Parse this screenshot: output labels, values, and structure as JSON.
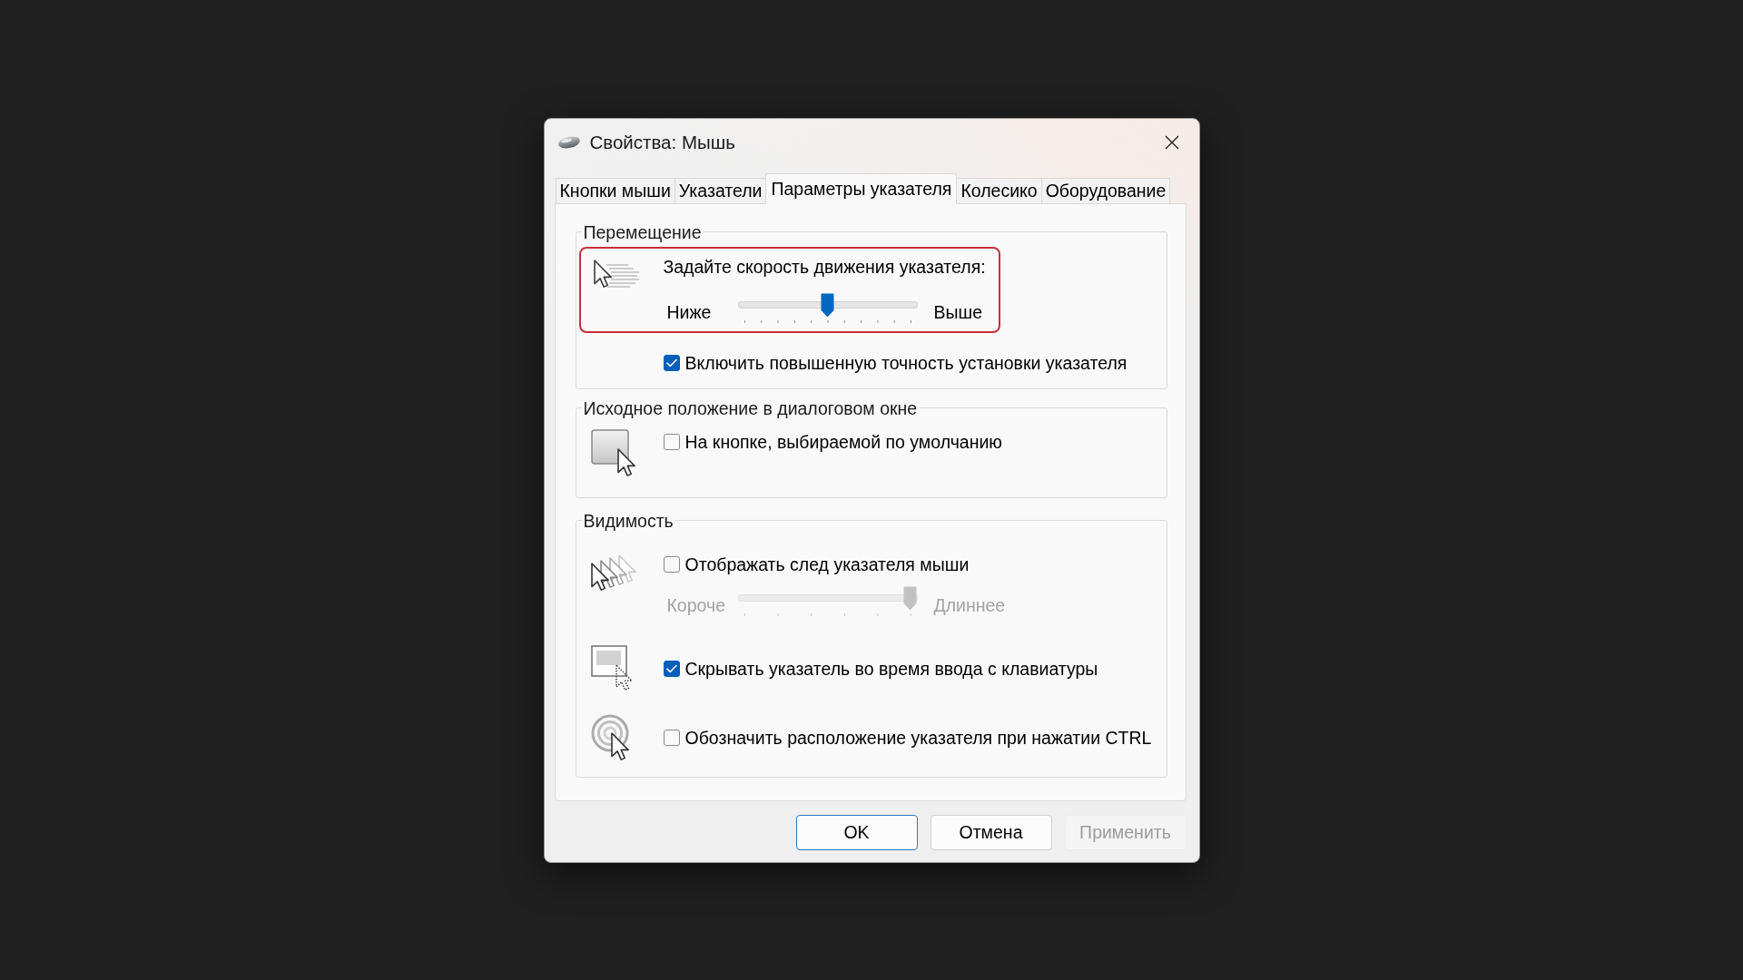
{
  "window": {
    "title": "Свойства: Мышь"
  },
  "tabs": [
    {
      "label": "Кнопки мыши",
      "selected": false
    },
    {
      "label": "Указатели",
      "selected": false
    },
    {
      "label": "Параметры указателя",
      "selected": true
    },
    {
      "label": "Колесико",
      "selected": false
    },
    {
      "label": "Оборудование",
      "selected": false
    }
  ],
  "groups": [
    {
      "title": "Перемещение",
      "sections": [
        {
          "highlighted": true,
          "controls": [
            {
              "kind": "label",
              "text": "Задайте скорость движения указателя:"
            },
            {
              "kind": "slider",
              "min_label": "Ниже",
              "max_label": "Выше",
              "level": 0.5,
              "disabled": false
            }
          ]
        },
        {
          "highlighted": false,
          "controls": [
            {
              "kind": "checkbox",
              "label": "Включить повышенную точность установки указателя",
              "checked": true
            }
          ]
        }
      ]
    },
    {
      "title": "Исходное положение в диалоговом окне",
      "sections": [
        {
          "highlighted": false,
          "controls": [
            {
              "kind": "checkbox",
              "label": "На кнопке, выбираемой по умолчанию",
              "checked": false
            }
          ]
        }
      ]
    },
    {
      "title": "Видимость",
      "sections": [
        {
          "highlighted": false,
          "controls": [
            {
              "kind": "checkbox",
              "label": "Отображать след указателя мыши",
              "checked": false
            },
            {
              "kind": "slider",
              "min_label": "Короче",
              "max_label": "Длиннее",
              "level": 1,
              "disabled": true
            }
          ]
        },
        {
          "highlighted": false,
          "controls": [
            {
              "kind": "checkbox",
              "label": "Скрывать указатель во время ввода с клавиатуры",
              "checked": true
            }
          ]
        },
        {
          "highlighted": false,
          "controls": [
            {
              "kind": "checkbox",
              "label": "Обозначить расположение указателя при нажатии CTRL",
              "checked": false
            }
          ]
        }
      ]
    }
  ],
  "buttons": [
    {
      "label": "OK",
      "default": true,
      "disabled": false
    },
    {
      "label": "Отмена",
      "default": false,
      "disabled": false
    },
    {
      "label": "Применить",
      "default": false,
      "disabled": true
    }
  ]
}
